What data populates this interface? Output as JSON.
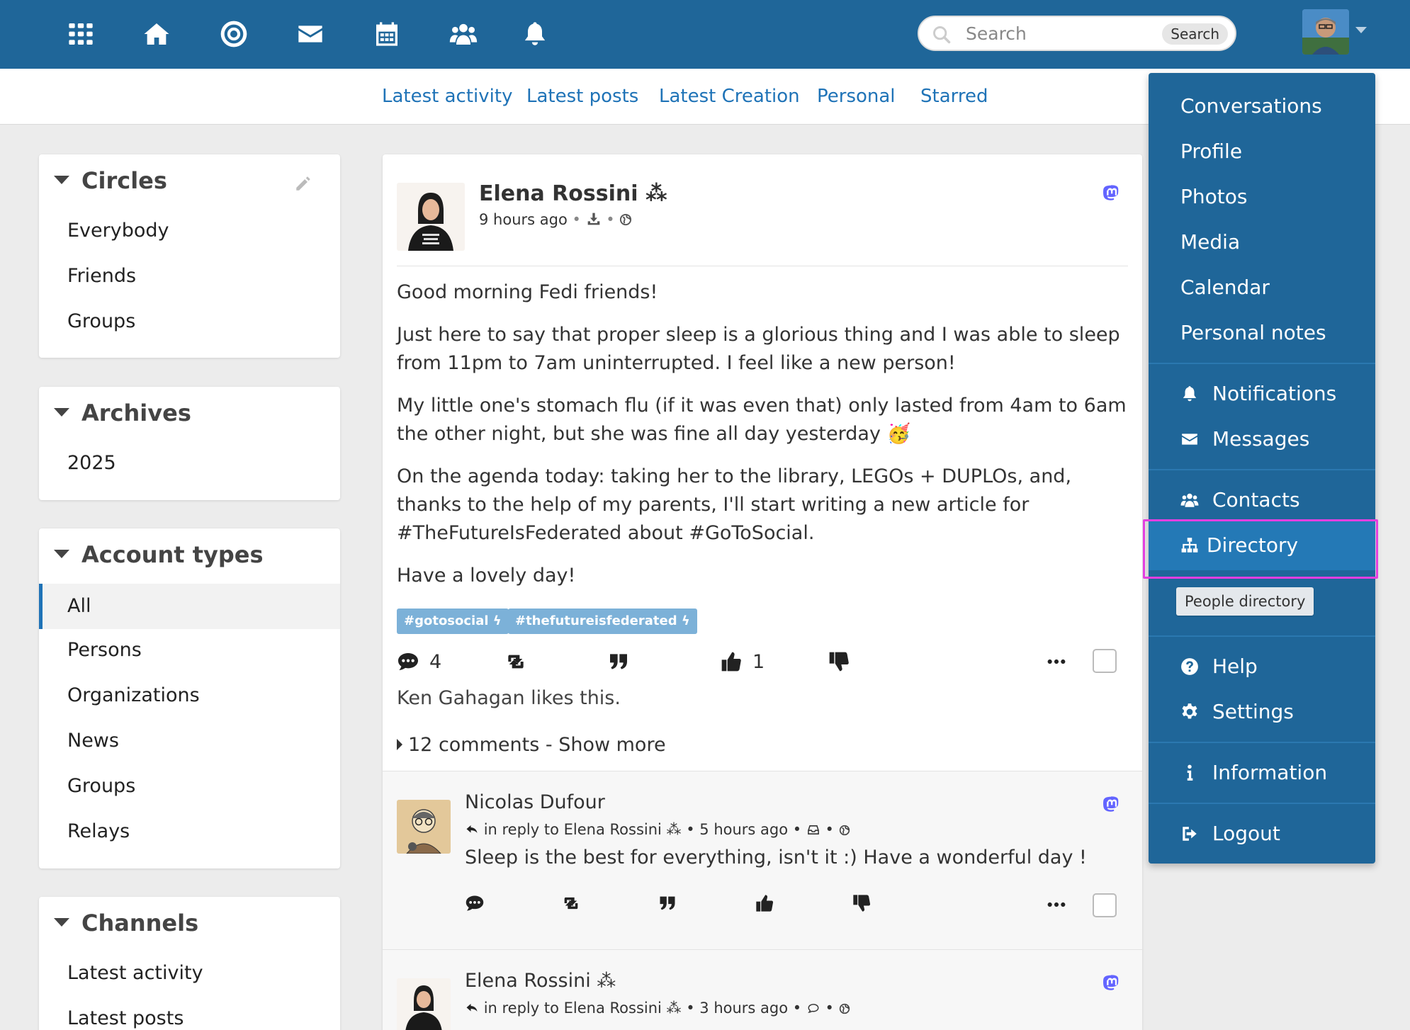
{
  "topbar": {
    "icons": [
      "apps-grid-icon",
      "home-icon",
      "target-icon",
      "envelope-icon",
      "calendar-icon",
      "group-icon",
      "bell-icon"
    ],
    "search_placeholder": "Search",
    "search_button": "Search",
    "color": "#1f6699"
  },
  "subnav": {
    "links": [
      "Latest activity",
      "Latest posts",
      "Latest Creation",
      "Personal",
      "Starred"
    ]
  },
  "sidebar": {
    "circles": {
      "title": "Circles",
      "items": [
        "Everybody",
        "Friends",
        "Groups"
      ]
    },
    "archives": {
      "title": "Archives",
      "items": [
        "2025"
      ]
    },
    "account_types": {
      "title": "Account types",
      "items": [
        "All",
        "Persons",
        "Organizations",
        "News",
        "Groups",
        "Relays"
      ],
      "selected": "All"
    },
    "channels": {
      "title": "Channels",
      "items": [
        "Latest activity",
        "Latest posts"
      ]
    }
  },
  "post": {
    "author": "Elena Rossini ⁂",
    "time": "9 hours ago",
    "paragraphs": [
      "Good morning Fedi friends!",
      "Just here to say that proper sleep is a glorious thing and I was able to sleep from 11pm to 7am uninterrupted. I feel like a new person!",
      "My little one's stomach flu (if it was even that) only lasted from 4am to 6am the other night, but she was fine all day yesterday 🥳",
      "On the agenda today: taking her to the library, LEGOs + DUPLOs, and, thanks to the help of my parents, I'll start writing a new article for #TheFutureIsFederated about #GoToSocial.",
      "Have a lovely day!"
    ],
    "tags": [
      "#gotosocial ϟ",
      "#thefutureisfederated ϟ"
    ],
    "comment_count": "4",
    "like_count": "1",
    "likes_line": "Ken Gahagan likes this.",
    "comments_toggle": "12 comments - Show more"
  },
  "comments": [
    {
      "author": "Nicolas Dufour",
      "reply_to": "in reply to Elena Rossini ⁂",
      "time": "5 hours ago",
      "text": "Sleep is the best for everything, isn't it :) Have a wonderful day !"
    },
    {
      "author": "Elena Rossini ⁂",
      "reply_to": "in reply to Elena Rossini ⁂",
      "time": "3 hours ago"
    }
  ],
  "dropdown": {
    "group1": [
      "Conversations",
      "Profile",
      "Photos",
      "Media",
      "Calendar",
      "Personal notes"
    ],
    "group2": [
      {
        "label": "Notifications",
        "icon": "bell-icon"
      },
      {
        "label": "Messages",
        "icon": "envelope-icon"
      }
    ],
    "group3": [
      {
        "label": "Contacts",
        "icon": "group-icon"
      },
      {
        "label": "Directory",
        "icon": "sitemap-icon"
      }
    ],
    "group4": [
      {
        "label": "Help",
        "icon": "question-icon"
      },
      {
        "label": "Settings",
        "icon": "gear-icon"
      }
    ],
    "group5": [
      {
        "label": "Information",
        "icon": "info-icon"
      }
    ],
    "group6": [
      {
        "label": "Logout",
        "icon": "logout-icon"
      }
    ],
    "tooltip": "People directory",
    "highlight_color": "#e33fe0"
  }
}
